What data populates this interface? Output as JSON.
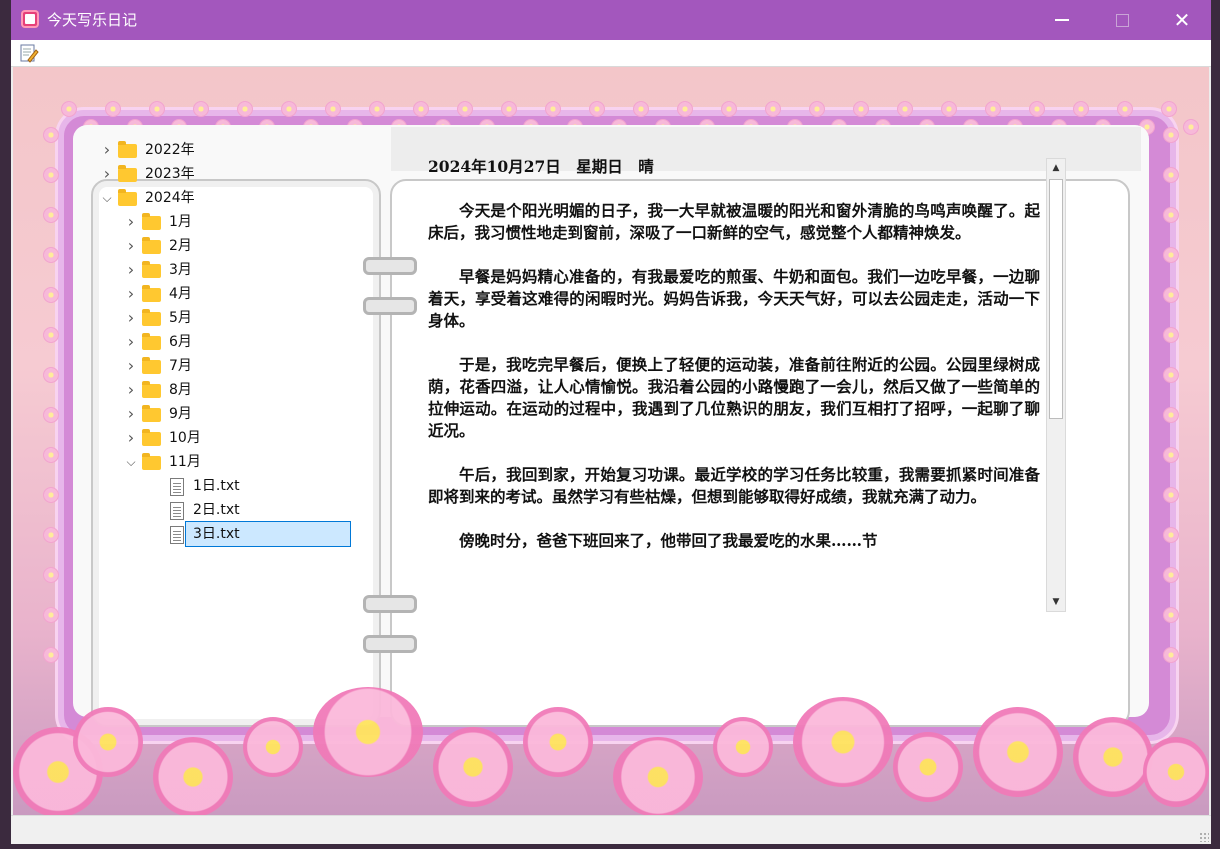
{
  "window": {
    "title": "今天写乐日记",
    "controls": [
      "minimize-icon",
      "maximize-icon",
      "close-icon"
    ]
  },
  "toolbar": {
    "edit_icon": "edit-notepad-icon"
  },
  "tree": {
    "years": [
      {
        "label": "2022年",
        "expanded": false
      },
      {
        "label": "2023年",
        "expanded": false
      },
      {
        "label": "2024年",
        "expanded": true
      }
    ],
    "months": [
      "1月",
      "2月",
      "3月",
      "4月",
      "5月",
      "6月",
      "7月",
      "8月",
      "9月",
      "10月",
      "11月"
    ],
    "files": [
      "1日.txt",
      "2日.txt",
      "3日.txt"
    ],
    "selected": "3日.txt"
  },
  "diary": {
    "date_line": "2024年10月27日　星期日　晴",
    "paragraphs": [
      "今天是个阳光明媚的日子，我一大早就被温暖的阳光和窗外清脆的鸟鸣声唤醒了。起床后，我习惯性地走到窗前，深吸了一口新鲜的空气，感觉整个人都精神焕发。",
      "早餐是妈妈精心准备的，有我最爱吃的煎蛋、牛奶和面包。我们一边吃早餐，一边聊着天，享受着这难得的闲暇时光。妈妈告诉我，今天天气好，可以去公园走走，活动一下身体。",
      "于是，我吃完早餐后，便换上了轻便的运动装，准备前往附近的公园。公园里绿树成荫，花香四溢，让人心情愉悦。我沿着公园的小路慢跑了一会儿，然后又做了一些简单的拉伸运动。在运动的过程中，我遇到了几位熟识的朋友，我们互相打了招呼，一起聊了聊近况。",
      "午后，我回到家，开始复习功课。最近学校的学习任务比较重，我需要抓紧时间准备即将到来的考试。虽然学习有些枯燥，但想到能够取得好成绩，我就充满了动力。",
      "傍晚时分，爸爸下班回来了，他带回了我最爱吃的水果……节"
    ]
  },
  "colors": {
    "titlebar": "#a357bd",
    "selection": "#cce8ff",
    "frame": "#d48ad6"
  }
}
